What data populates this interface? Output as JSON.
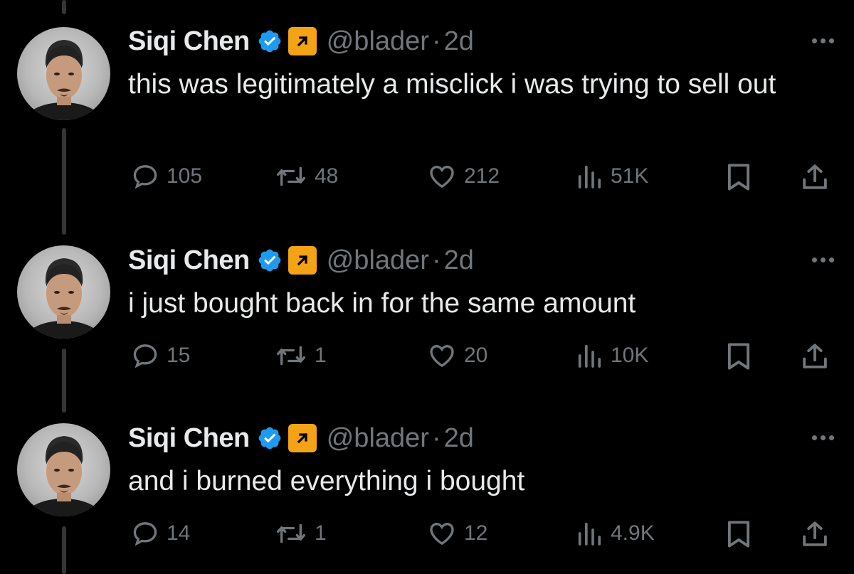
{
  "colors": {
    "background": "#000000",
    "text": "#e7e9ea",
    "muted": "#71767b",
    "verified": "#1d9bf0",
    "affiliate": "#f4a316",
    "thread_line": "#333639"
  },
  "tweets": [
    {
      "name": "Siqi Chen",
      "handle": "@blader",
      "separator": "·",
      "time": "2d",
      "text": "this was legitimately a misclick i was trying to sell out",
      "replies": "105",
      "reposts": "48",
      "likes": "212",
      "views": "51K"
    },
    {
      "name": "Siqi Chen",
      "handle": "@blader",
      "separator": "·",
      "time": "2d",
      "text": "i just bought back in for the same amount",
      "replies": "15",
      "reposts": "1",
      "likes": "20",
      "views": "10K"
    },
    {
      "name": "Siqi Chen",
      "handle": "@blader",
      "separator": "·",
      "time": "2d",
      "text": "and i burned everything i bought",
      "replies": "14",
      "reposts": "1",
      "likes": "12",
      "views": "4.9K"
    }
  ],
  "icons": {
    "verified": "verified-badge-icon",
    "affiliate": "affiliate-arrow-icon",
    "more": "more-icon",
    "reply": "reply-icon",
    "repost": "repost-icon",
    "like": "like-icon",
    "views": "views-icon",
    "bookmark": "bookmark-icon",
    "share": "share-icon"
  }
}
